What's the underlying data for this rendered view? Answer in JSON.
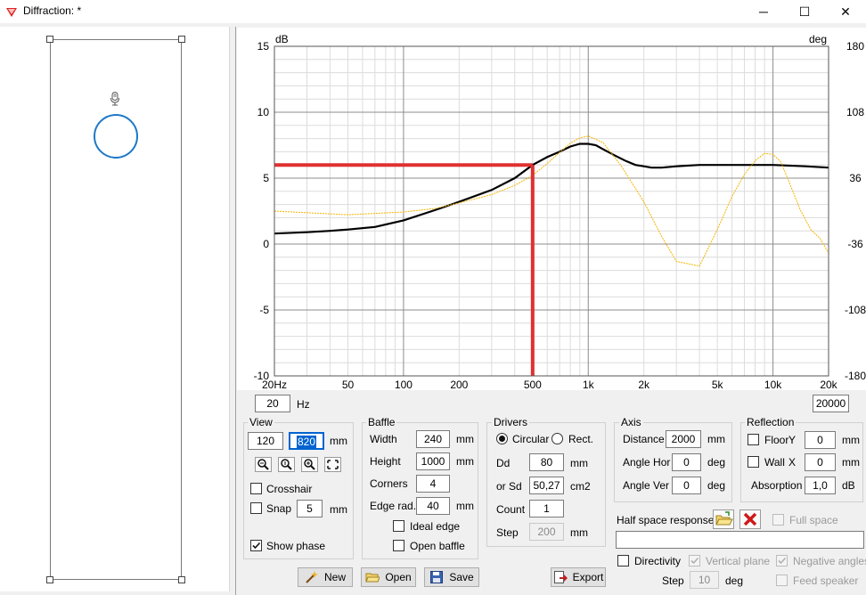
{
  "window": {
    "title": "Diffraction: *",
    "minimize": "─",
    "maximize": "☐",
    "close": "✕"
  },
  "chart_data": {
    "type": "line",
    "xscale": "log",
    "xlim": [
      20,
      20000
    ],
    "ylim": [
      -10,
      15
    ],
    "y2lim": [
      -180,
      180
    ],
    "ylabel": "dB",
    "y2label": "deg",
    "x_ticks": [
      {
        "v": 20,
        "t": "20Hz"
      },
      {
        "v": 50,
        "t": "50"
      },
      {
        "v": 100,
        "t": "100"
      },
      {
        "v": 200,
        "t": "200"
      },
      {
        "v": 500,
        "t": "500"
      },
      {
        "v": 1000,
        "t": "1k"
      },
      {
        "v": 2000,
        "t": "2k"
      },
      {
        "v": 5000,
        "t": "5k"
      },
      {
        "v": 10000,
        "t": "10k"
      },
      {
        "v": 20000,
        "t": "20k"
      }
    ],
    "y_ticks": [
      15,
      10,
      5,
      0,
      -5,
      -10
    ],
    "y2_ticks": [
      180,
      108,
      36,
      -36,
      -108,
      -180
    ],
    "grid": true,
    "series": [
      {
        "role": "magnitude",
        "color": "#000000",
        "axis": "left",
        "x": [
          20,
          30,
          40,
          50,
          70,
          100,
          150,
          200,
          300,
          400,
          500,
          600,
          700,
          800,
          900,
          1000,
          1100,
          1200,
          1400,
          1600,
          1800,
          2000,
          2200,
          2500,
          3000,
          4000,
          5000,
          7000,
          10000,
          15000,
          20000
        ],
        "y": [
          0.8,
          0.9,
          1.0,
          1.1,
          1.3,
          1.8,
          2.6,
          3.2,
          4.1,
          5.0,
          6.0,
          6.6,
          7.0,
          7.4,
          7.6,
          7.6,
          7.5,
          7.2,
          6.7,
          6.3,
          6.0,
          5.9,
          5.8,
          5.8,
          5.9,
          6.0,
          6.0,
          6.0,
          6.0,
          5.9,
          5.8
        ]
      },
      {
        "role": "phase",
        "color": "#f5b400",
        "axis": "right",
        "x": [
          20,
          50,
          100,
          150,
          200,
          300,
          400,
          500,
          600,
          700,
          800,
          900,
          1000,
          1200,
          1500,
          2000,
          2500,
          3000,
          4000,
          5000,
          6000,
          7000,
          8000,
          9000,
          10000,
          11000,
          12000,
          14000,
          16000,
          18000,
          20000
        ],
        "y": [
          0,
          -4,
          -1,
          3,
          9,
          18,
          28,
          39,
          52,
          64,
          74,
          80,
          82,
          75,
          50,
          10,
          -28,
          -55,
          -60,
          -20,
          16,
          40,
          55,
          63,
          62,
          54,
          36,
          2,
          -20,
          -30,
          -46
        ]
      }
    ],
    "annotation": {
      "color": "#e03030",
      "x": 500,
      "y": 6
    }
  },
  "freq_min": "20",
  "freq_unit": "Hz",
  "freq_max": "20000",
  "view": {
    "title": "View",
    "width": "120",
    "height": "820",
    "unit": "mm",
    "crosshair": "Crosshair",
    "snap": "Snap",
    "snap_value": "5",
    "snap_unit": "mm",
    "show_phase": "Show phase"
  },
  "baffle": {
    "title": "Baffle",
    "width_label": "Width",
    "width": "240",
    "height_label": "Height",
    "height": "1000",
    "corners_label": "Corners",
    "corners": "4",
    "edge_label": "Edge rad.",
    "edge": "40",
    "unit": "mm",
    "ideal_edge": "Ideal edge",
    "open_baffle": "Open baffle"
  },
  "drivers": {
    "title": "Drivers",
    "circular": "Circular",
    "rect": "Rect.",
    "dd_label": "Dd",
    "dd": "80",
    "dd_unit": "mm",
    "sd_label": "or Sd",
    "sd": "50,27",
    "sd_unit": "cm2",
    "count_label": "Count",
    "count": "1",
    "step_label": "Step",
    "step": "200",
    "step_unit": "mm"
  },
  "axis": {
    "title": "Axis",
    "distance_label": "Distance",
    "distance": "2000",
    "distance_unit": "mm",
    "hor_label": "Angle Hor",
    "hor": "0",
    "ver_label": "Angle Ver",
    "ver": "0",
    "deg": "deg"
  },
  "reflection": {
    "title": "Reflection",
    "floor_label": "Floor",
    "floor_axis": "Y",
    "floor": "0",
    "wall_label": "Wall",
    "wall_axis": "X",
    "wall": "0",
    "unit": "mm",
    "absorption_label": "Absorption",
    "absorption": "1,0",
    "absorption_unit": "dB"
  },
  "half_space": {
    "label": "Half space response",
    "full_space": "Full space"
  },
  "directivity": {
    "label": "Directivity",
    "vertical_plane": "Vertical plane",
    "negative_angles": "Negative angles",
    "step_label": "Step",
    "step": "10",
    "step_unit": "deg",
    "feed_speaker": "Feed speaker"
  },
  "buttons": {
    "new": "New",
    "open": "Open",
    "save": "Save",
    "export": "Export"
  }
}
